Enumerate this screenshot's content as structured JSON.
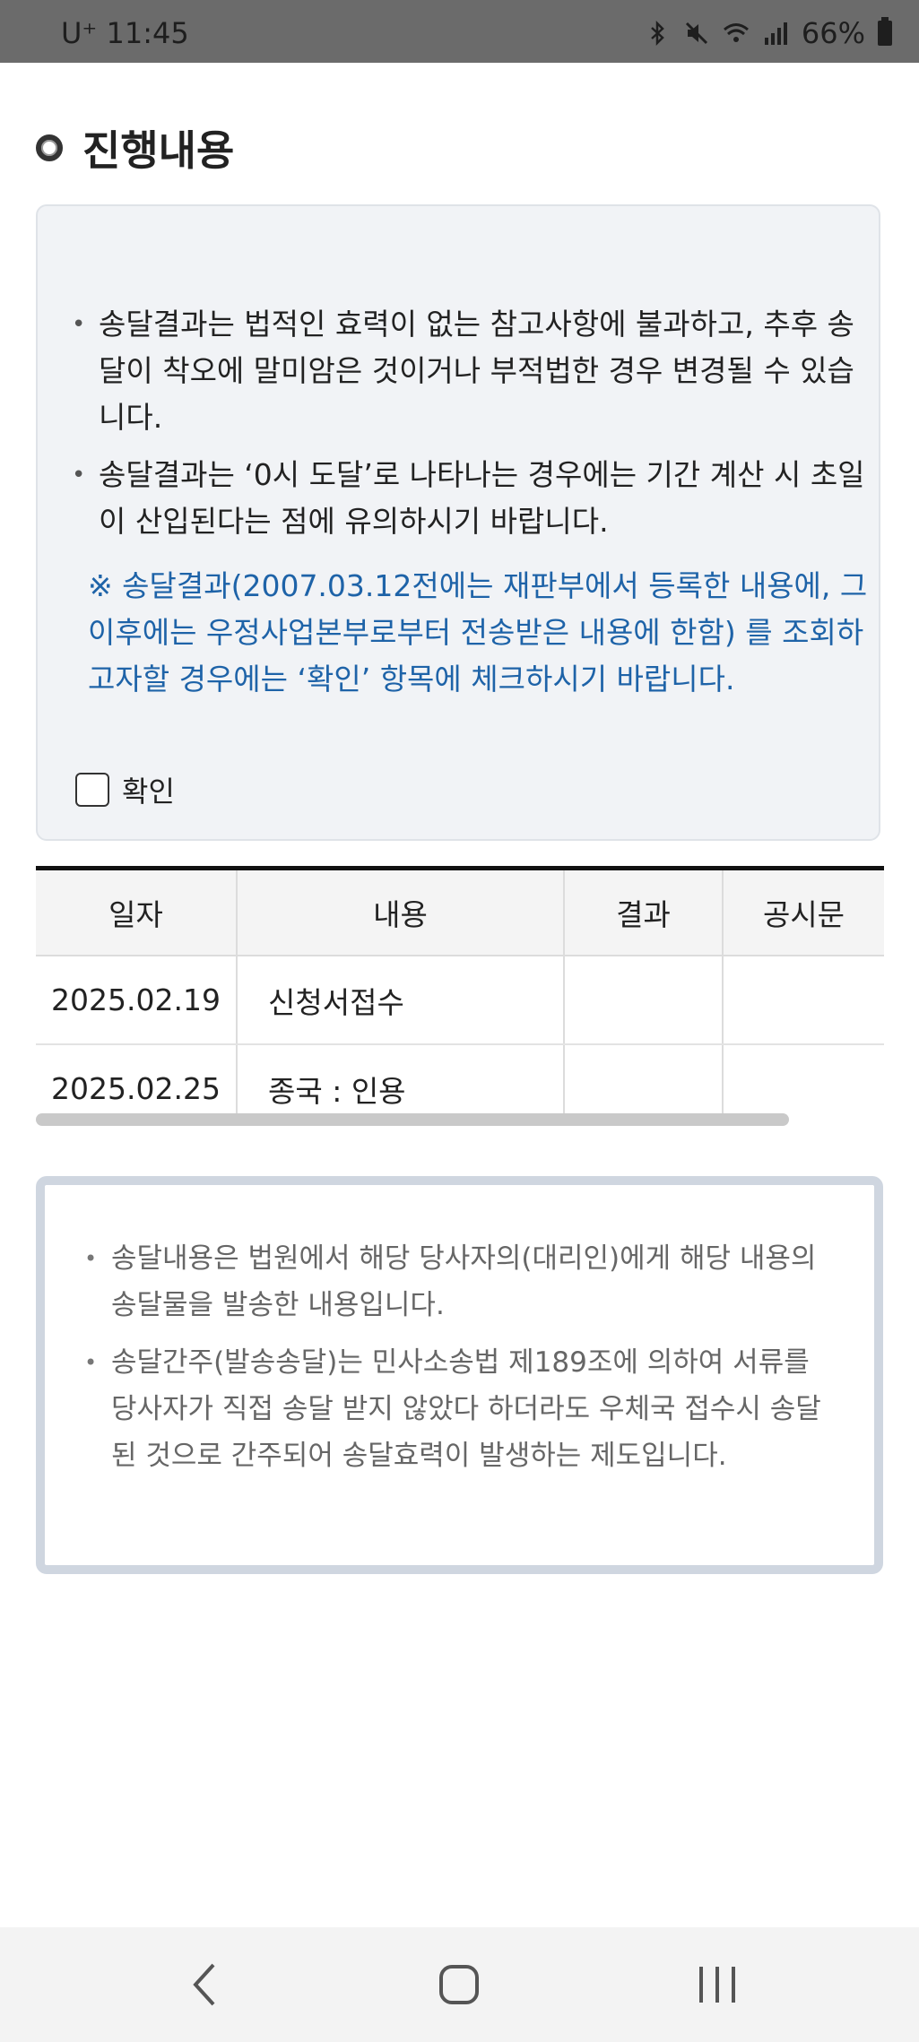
{
  "status_bar": {
    "carrier_time": "U⁺ 11:45",
    "battery": "66%",
    "icons": [
      "bluetooth-icon",
      "mute-icon",
      "wifi-icon",
      "signal-icon",
      "battery-icon"
    ]
  },
  "section": {
    "title": "진행내용"
  },
  "notice": {
    "items": [
      "송달결과는 법적인 효력이 없는 참고사항에 불과하고, 추후 송달이 착오에 말미암은 것이거나 부적법한 경우 변경될 수 있습니다.",
      "송달결과는 ‘0시 도달’로 나타나는 경우에는 기간 계산 시 초일이 산입된다는 점에 유의하시기 바랍니다."
    ],
    "blue_note": "※ 송달결과(2007.03.12전에는 재판부에서 등록한 내용에, 그 이후에는 우정사업본부로부터 전송받은 내용에 한함) 를 조회하고자할 경우에는 ‘확인’ 항목에 체크하시기 바랍니다.",
    "checkbox_label": "확인",
    "checkbox_checked": false
  },
  "table": {
    "headers": [
      "일자",
      "내용",
      "결과",
      "공시문"
    ],
    "rows": [
      {
        "date": "2025.02.19",
        "content": "신청서접수",
        "result": "",
        "notice": ""
      },
      {
        "date": "2025.02.25",
        "content": "종국 : 인용",
        "result": "",
        "notice": ""
      }
    ]
  },
  "info": {
    "items": [
      "송달내용은 법원에서 해당 당사자의(대리인)에게 해당 내용의 송달물을 발송한 내용입니다.",
      "송달간주(발송송달)는 민사소송법 제189조에 의하여 서류를 당사자가 직접 송달 받지 않았다 하더라도 우체국 접수시 송달된 것으로 간주되어 송달효력이 발생하는 제도입니다."
    ]
  },
  "nav": {
    "icons": [
      "back-icon",
      "home-icon",
      "recent-apps-icon"
    ]
  }
}
